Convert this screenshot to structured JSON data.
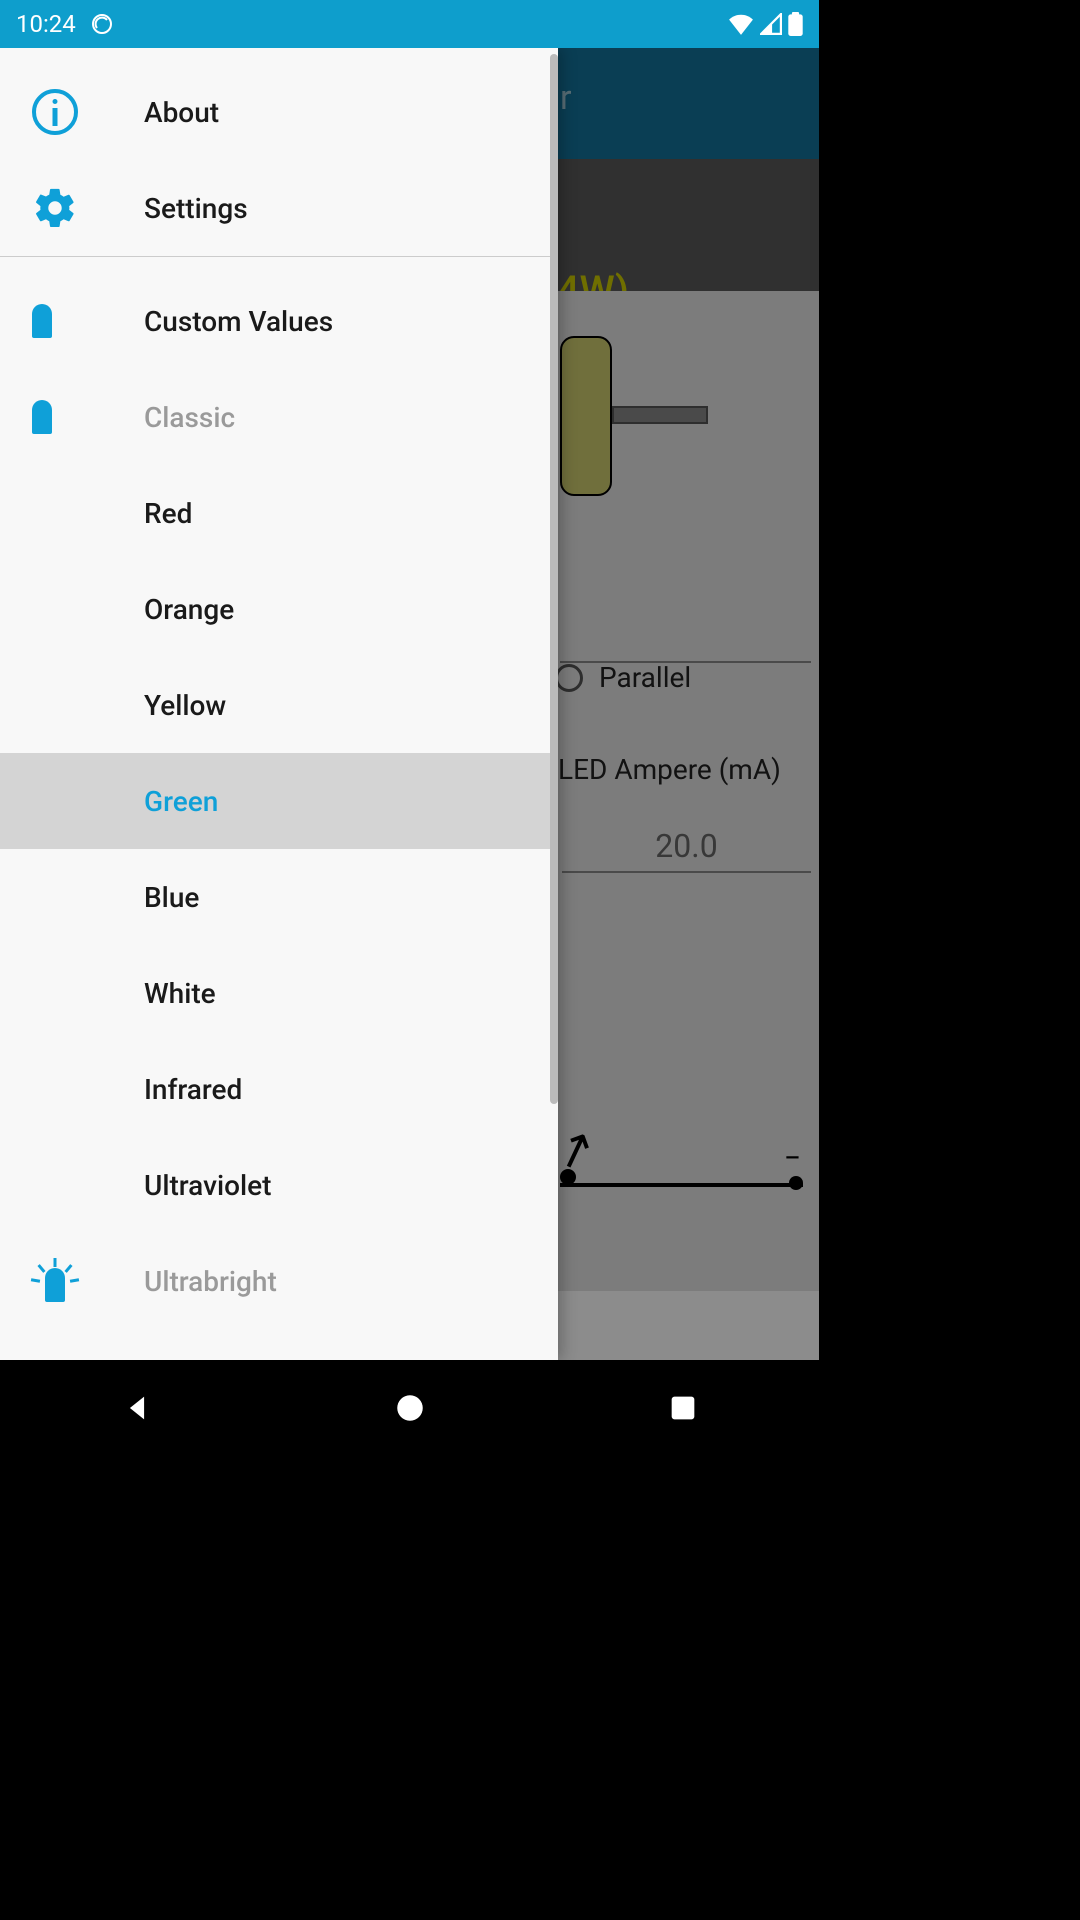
{
  "status_bar": {
    "time": "10:24"
  },
  "drawer": {
    "about": "About",
    "settings": "Settings",
    "custom_values": "Custom Values",
    "classic": "Classic",
    "items": [
      {
        "label": "Red"
      },
      {
        "label": "Orange"
      },
      {
        "label": "Yellow"
      },
      {
        "label": "Green",
        "selected": true
      },
      {
        "label": "Blue"
      },
      {
        "label": "White"
      },
      {
        "label": "Infrared"
      },
      {
        "label": "Ultraviolet"
      }
    ],
    "ultrabright": "Ultrabright"
  },
  "content": {
    "app_title_fragment": "r",
    "wattage_fragment": "4W)",
    "radio_label": "Parallel",
    "field_label": "LED Ampere (mA)",
    "field_value": "20.0",
    "schematic_minus": "−"
  }
}
